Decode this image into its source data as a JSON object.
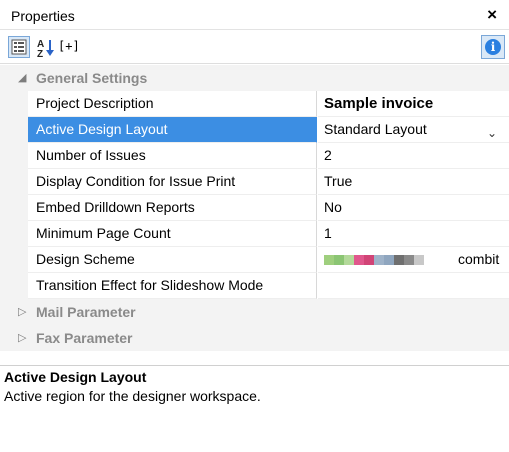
{
  "window": {
    "title": "Properties",
    "close_glyph": "×"
  },
  "toolbar": {
    "categorized_icon": "categorized-view-icon",
    "alpha_icon": "sort-alphabetical-icon",
    "alpha_label": "A↓Z",
    "expand_label": "[+]",
    "info_label": "i",
    "accent_color": "#2a7fe0"
  },
  "categories": [
    {
      "name": "General Settings",
      "expanded": true
    },
    {
      "name": "Mail Parameter",
      "expanded": false
    },
    {
      "name": "Fax Parameter",
      "expanded": false
    }
  ],
  "properties": [
    {
      "name": "Project Description",
      "value": "Sample invoice"
    },
    {
      "name": "Active Design Layout",
      "value": "Standard Layout",
      "selected": true
    },
    {
      "name": "Number of Issues",
      "value": "2"
    },
    {
      "name": "Display Condition for Issue Print",
      "value": "True"
    },
    {
      "name": "Embed Drilldown Reports",
      "value": "No"
    },
    {
      "name": "Minimum Page Count",
      "value": "1"
    },
    {
      "name": "Design Scheme",
      "value": "combit"
    },
    {
      "name": "Transition Effect for Slideshow Mode",
      "value": ""
    }
  ],
  "scheme_colors": [
    "#9fcf7e",
    "#8bc573",
    "#b3d99a",
    "#e0578c",
    "#d14476",
    "#9fb3c9",
    "#8fa6bf",
    "#6f6f6f",
    "#8a8a8a",
    "#c8c8c8"
  ],
  "selection_color": "#3c8ee3",
  "description": {
    "title": "Active Design Layout",
    "text": "Active region for the designer workspace."
  }
}
